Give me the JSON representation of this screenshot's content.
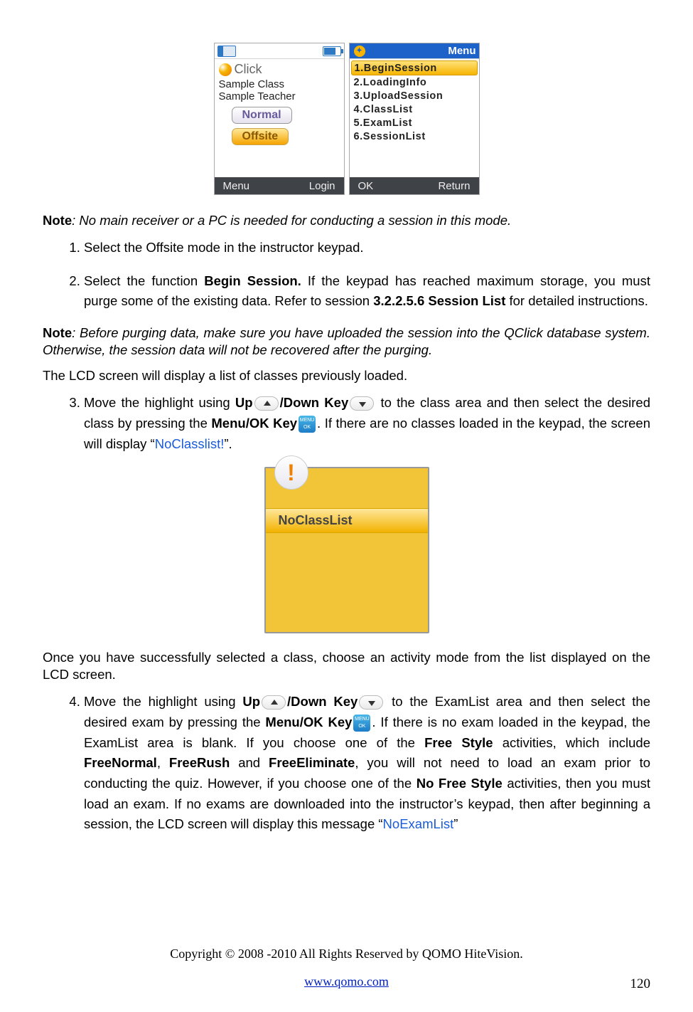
{
  "phone1": {
    "brand": "Click",
    "line1": "Sample Class",
    "line2": "Sample Teacher",
    "btn_normal": "Normal",
    "btn_offsite": "Offsite",
    "soft_left": "Menu",
    "soft_right": "Login"
  },
  "phone2": {
    "menu_title": "Menu",
    "items": [
      "1.BeginSession",
      "2.LoadingInfo",
      "3.UploadSession",
      "4.ClassList",
      "5.ExamList",
      "6.SessionList"
    ],
    "soft_left": "OK",
    "soft_right": "Return"
  },
  "note1_label": "Note",
  "note1_text": ": No main receiver or a PC is needed for conducting a session in this mode.",
  "steps": {
    "s1": "Select the Offsite mode in the instructor keypad.",
    "s2_a": "Select the function ",
    "s2_b": "Begin Session.",
    "s2_c": " If the keypad has reached maximum storage, you must purge some of the existing data. Refer to session ",
    "s2_d": "3.2.2.5.6 Session List",
    "s2_e": " for detailed instructions.",
    "s3_a": "Move the highlight using ",
    "s3_up": "Up",
    "s3_mid": "/Down Key",
    "s3_b": " to the class area and then select the desired class by pressing the ",
    "s3_menuok": "Menu/OK Key",
    "s3_c": ". If there are no classes loaded in the keypad, the screen will display “",
    "s3_blue": "NoClasslist!",
    "s3_d": "”.",
    "s4_a": "Move the highlight using ",
    "s4_up": "Up",
    "s4_mid": "/Down Key",
    "s4_b": " to the ExamList area and then select the desired exam by pressing the ",
    "s4_menuok": "Menu/OK Key",
    "s4_c": ". If there is no exam loaded in the keypad, the ExamList area is blank. If you choose one of the ",
    "s4_free": "Free Style",
    "s4_d": " activities, which include ",
    "s4_fn": "FreeNormal",
    "s4_comma1": ", ",
    "s4_fr": "FreeRush",
    "s4_and": " and ",
    "s4_fe": "FreeEliminate",
    "s4_e": ", you will not need to load an exam prior to conducting the quiz. However, if you choose one of the ",
    "s4_nfs": "No Free Style",
    "s4_f": " activities, then you must load an exam. If no exams are downloaded into the instructor’s keypad, then after beginning a session, the LCD screen will display this message “",
    "s4_blue": "NoExamList",
    "s4_g": "”"
  },
  "note2_label": "Note",
  "note2_text": ": Before purging data, make sure you have uploaded the session into the QClick database system. Otherwise, the session data will not be recovered after the purging.",
  "para_after_note2": "The LCD screen will display a list of classes previously loaded.",
  "noclass_title": "NoClassList",
  "para_after_noclass": "Once you have successfully selected a class, choose an activity mode from the list displayed on the LCD screen.",
  "okkey_top": "MENU",
  "okkey_bot": "OK",
  "footer_copyright": "Copyright © 2008 -2010 All Rights Reserved by QOMO HiteVision.",
  "footer_url": "www.qomo.com",
  "page_number": "120"
}
